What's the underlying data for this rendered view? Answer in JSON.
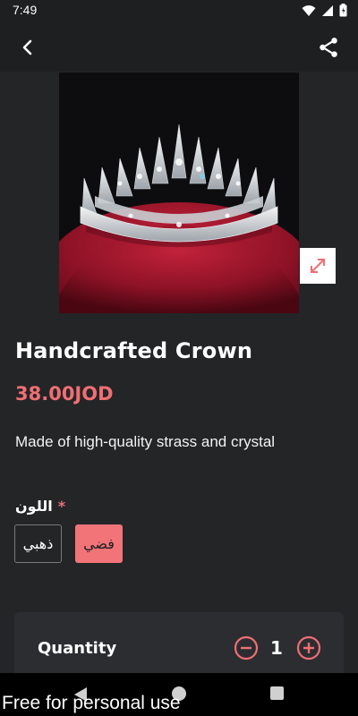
{
  "status_bar": {
    "time": "7:49"
  },
  "app_bar": {
    "back_icon": "arrow-back-icon",
    "share_icon": "share-icon"
  },
  "product": {
    "image_desc": "crystal crown on red cushion",
    "title": "Handcrafted Crown",
    "price": "38.00JOD",
    "description": "Made of high-quality strass and crystal"
  },
  "options": {
    "label": "اللون",
    "required_mark": "*",
    "choices": [
      {
        "label": "ذهبي",
        "selected": false
      },
      {
        "label": "فضي",
        "selected": true
      }
    ]
  },
  "quantity": {
    "label": "Quantity",
    "value": "1"
  },
  "watermark": "Free for personal use",
  "colors": {
    "accent": "#ef6f73",
    "background": "#242527",
    "card": "#2c2d30"
  }
}
